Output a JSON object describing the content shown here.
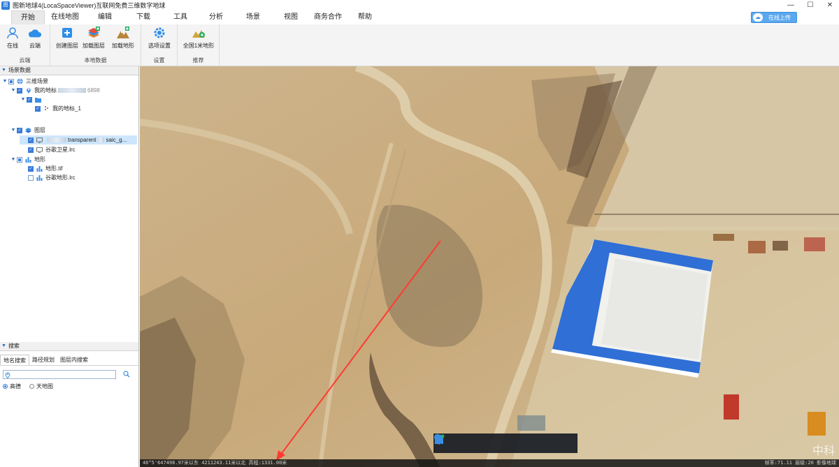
{
  "window": {
    "title": "图新地球4(LocaSpaceViewer)互联网免费三维数字地球",
    "app_icon_text": "图",
    "controls": [
      "—",
      "☐",
      "✕"
    ]
  },
  "menu": {
    "tabs": [
      "开始",
      "在线地图",
      "编辑",
      "下载",
      "工具",
      "分析",
      "场景",
      "视图",
      "商务合作",
      "帮助"
    ],
    "online_upload": "在线上传"
  },
  "ribbon": {
    "groups": [
      {
        "label": "云端",
        "buttons": [
          {
            "label": "在线",
            "icon": "user-icon"
          },
          {
            "label": "云端",
            "icon": "cloud-icon"
          }
        ]
      },
      {
        "label": "本地数据",
        "buttons": [
          {
            "label": "创建图层",
            "icon": "create-layer-icon"
          },
          {
            "label": "加载图层",
            "icon": "load-layer-icon"
          },
          {
            "label": "加载地形",
            "icon": "load-terrain-icon"
          }
        ]
      },
      {
        "label": "设置",
        "buttons": [
          {
            "label": "选项设置",
            "icon": "gear-icon"
          }
        ]
      },
      {
        "label": "推荐",
        "buttons": [
          {
            "label": "全国1米地形",
            "icon": "terrain-recommend-icon"
          }
        ]
      }
    ]
  },
  "scene_panel": {
    "header": "场景数据",
    "tree": [
      {
        "label": "三维场景",
        "checked": "partial",
        "expanded": true
      },
      {
        "label": "我的地标",
        "suffix": "6898",
        "checked": "on",
        "expanded": true
      },
      {
        "label": "",
        "checked": "on",
        "expanded": true
      },
      {
        "label": "我的地标_1",
        "checked": "on"
      },
      {
        "label": "图层",
        "checked": "on",
        "expanded": true
      },
      {
        "label": "transparent",
        "suffix": "saic_g...",
        "checked": "on",
        "selected": true
      },
      {
        "label": "谷歌卫星.lrc",
        "checked": "on"
      },
      {
        "label": "地形",
        "checked": "partial",
        "expanded": true
      },
      {
        "label": "地形.tif",
        "checked": "on"
      },
      {
        "label": "谷歌地形.lrc",
        "checked": "off"
      }
    ]
  },
  "search_panel": {
    "header": "搜索",
    "tabs": [
      "地名搜索",
      "路径规划",
      "图层内搜索"
    ],
    "search_value": "",
    "radios": [
      {
        "label": "高德",
        "on": true
      },
      {
        "label": "天地图",
        "on": false
      }
    ]
  },
  "map": {
    "toolbar": [
      "pan-hand-icon",
      "select-arrow-icon",
      "placemark-icon",
      "line-icon",
      "polygon-icon",
      "chart-icon"
    ],
    "status_left": "46°5'647498.97米以东  4211243.11米以北  高程:1331.00米",
    "status_right": "帧率:71.11  层级:20  影像地球",
    "watermark": "中科"
  },
  "colors": {
    "accent": "#3b7dd8",
    "roof_blue": "#2f6fd6",
    "measure_line": "#ff3b30"
  }
}
